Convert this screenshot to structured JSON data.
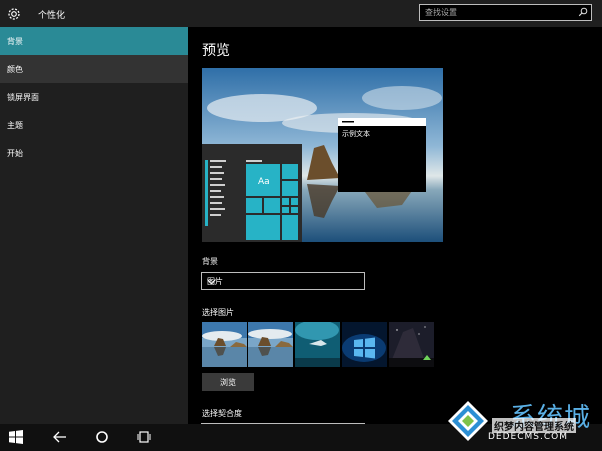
{
  "app": {
    "title": "个性化"
  },
  "search": {
    "placeholder": "查找设置"
  },
  "sidebar": {
    "items": [
      {
        "label": "背景",
        "active": true
      },
      {
        "label": "颜色",
        "active": false
      },
      {
        "label": "锁屏界面",
        "active": false
      },
      {
        "label": "主题",
        "active": false
      },
      {
        "label": "开始",
        "active": false
      }
    ]
  },
  "main": {
    "title": "预览",
    "preview": {
      "tile_label": "Aa",
      "window_text": "示例文本"
    },
    "background": {
      "label": "背景",
      "value": "图片"
    },
    "choose_picture": {
      "label": "选择图片",
      "browse_label": "浏览"
    },
    "fit": {
      "label": "选择契合度"
    }
  },
  "watermark": {
    "big": "系统城",
    "sub": "织梦内容管理系统",
    "url": "DEDECMS.COM"
  },
  "colors": {
    "accent": "#2a8a96",
    "tile": "#27b3c6",
    "sidebar": "#1f1f1f",
    "background": "#000000"
  },
  "icons": {
    "settings": "gear-icon",
    "search": "search-icon",
    "dropdown": "chevron-down-icon",
    "start": "windows-logo-icon",
    "back": "back-arrow-icon",
    "home": "circle-icon",
    "task_view": "task-view-icon"
  }
}
